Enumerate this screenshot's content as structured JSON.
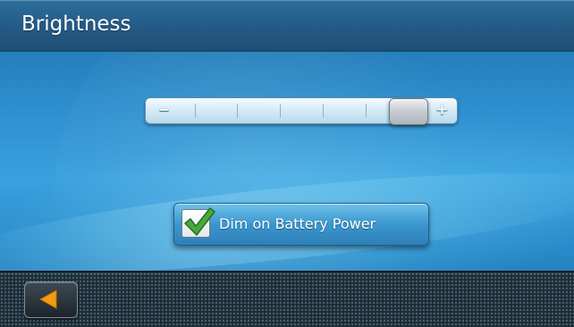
{
  "header": {
    "title": "Brightness"
  },
  "brightness_slider": {
    "minus_symbol": "−",
    "plus_symbol": "+",
    "ticks": 6,
    "level": 0.92
  },
  "dim_on_battery": {
    "label": "Dim on Battery Power",
    "checked": true
  },
  "footer": {
    "back_icon": "back-arrow-icon"
  },
  "colors": {
    "accent": "#f39c12",
    "checkmark": "#48a83a"
  }
}
